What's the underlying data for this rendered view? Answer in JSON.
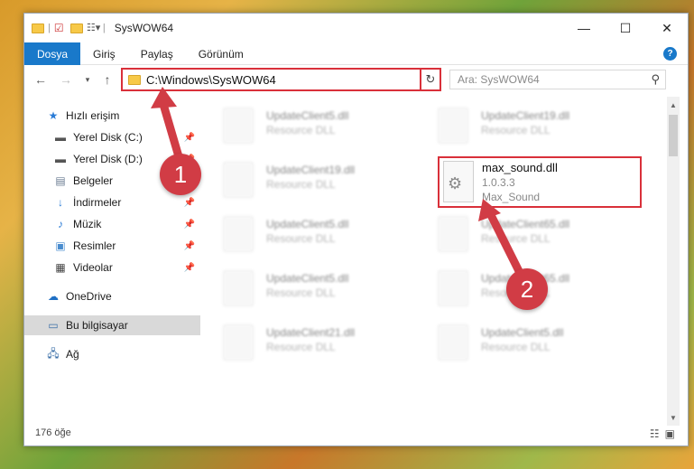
{
  "window": {
    "title": "SysWOW64"
  },
  "ribbon": {
    "tabs": [
      "Dosya",
      "Giriş",
      "Paylaş",
      "Görünüm"
    ],
    "help_label": "?"
  },
  "address": {
    "path": "C:\\Windows\\SysWOW64"
  },
  "search": {
    "placeholder": "Ara: SysWOW64"
  },
  "sidebar": {
    "items": [
      {
        "label": "Hızlı erişim",
        "icon": "star-icon"
      },
      {
        "label": "Yerel Disk (C:)",
        "icon": "drive-icon",
        "pinned": true
      },
      {
        "label": "Yerel Disk (D:)",
        "icon": "drive-icon",
        "pinned": true
      },
      {
        "label": "Belgeler",
        "icon": "document-icon",
        "pinned": true
      },
      {
        "label": "İndirmeler",
        "icon": "download-icon",
        "pinned": true
      },
      {
        "label": "Müzik",
        "icon": "music-icon",
        "pinned": true
      },
      {
        "label": "Resimler",
        "icon": "pictures-icon",
        "pinned": true
      },
      {
        "label": "Videolar",
        "icon": "video-icon",
        "pinned": true
      },
      {
        "label": "OneDrive",
        "icon": "cloud-icon"
      },
      {
        "label": "Bu bilgisayar",
        "icon": "computer-icon",
        "selected": true
      },
      {
        "label": "Ağ",
        "icon": "network-icon"
      }
    ]
  },
  "files": [
    {
      "name": "UpdateClient5.dll",
      "desc": "Resource DLL"
    },
    {
      "name": "UpdateClient19.dll",
      "desc": "Resource DLL"
    },
    {
      "name": "UpdateClient19.dll",
      "desc": "Resource DLL"
    },
    {
      "name": "UpdateClient5.dll",
      "desc": "Resource DLL"
    },
    {
      "name": "UpdateClient65.dll",
      "desc": "Resource DLL"
    },
    {
      "name": "UpdateClient5.dll",
      "desc": "Resource DLL"
    },
    {
      "name": "UpdateClient65.dll",
      "desc": "Resource DLL"
    },
    {
      "name": "UpdateClient21.dll",
      "desc": "Resource DLL"
    },
    {
      "name": "UpdateClient5.dll",
      "desc": "Resource DLL"
    }
  ],
  "highlighted_file": {
    "name": "max_sound.dll",
    "version": "1.0.3.3",
    "product": "Max_Sound"
  },
  "status": {
    "count": "176 öğe"
  },
  "annotations": {
    "step1": "1",
    "step2": "2"
  },
  "colors": {
    "accent": "#1979ca",
    "highlight": "#d9303a",
    "badge": "#d13c45"
  }
}
